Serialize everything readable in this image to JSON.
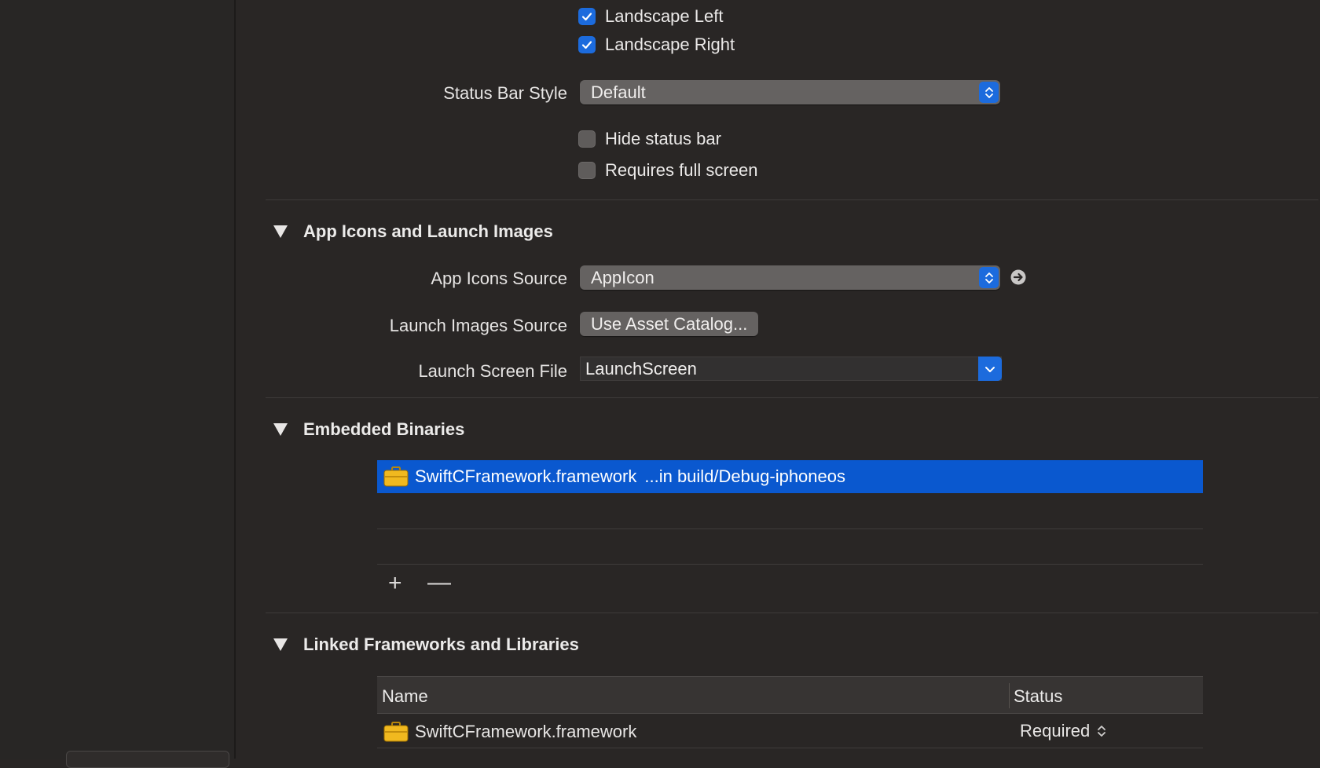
{
  "orientation": {
    "landscape_left": {
      "label": "Landscape Left",
      "checked": true
    },
    "landscape_right": {
      "label": "Landscape Right",
      "checked": true
    }
  },
  "status_bar": {
    "style_label": "Status Bar Style",
    "style_value": "Default",
    "hide_label": "Hide status bar",
    "hide_checked": false,
    "fullscreen_label": "Requires full screen",
    "fullscreen_checked": false
  },
  "app_icons": {
    "title": "App Icons and Launch Images",
    "source_label": "App Icons Source",
    "source_value": "AppIcon",
    "launch_images_label": "Launch Images Source",
    "launch_images_button": "Use Asset Catalog...",
    "launch_screen_label": "Launch Screen File",
    "launch_screen_value": "LaunchScreen"
  },
  "embedded": {
    "title": "Embedded Binaries",
    "rows": [
      {
        "name": "SwiftCFramework.framework",
        "path": "...in build/Debug-iphoneos"
      }
    ],
    "add": "+",
    "remove": "—"
  },
  "linked": {
    "title": "Linked Frameworks and Libraries",
    "col_name": "Name",
    "col_status": "Status",
    "rows": [
      {
        "name": "SwiftCFramework.framework",
        "status": "Required"
      }
    ]
  },
  "colors": {
    "accent": "#1c6bdd",
    "selection": "#0a58cf",
    "background": "#292625"
  },
  "icons": [
    "checkmark-icon",
    "updown-arrows-icon",
    "chevron-down-icon",
    "go-arrow-icon",
    "disclosure-triangle-icon",
    "framework-icon"
  ]
}
